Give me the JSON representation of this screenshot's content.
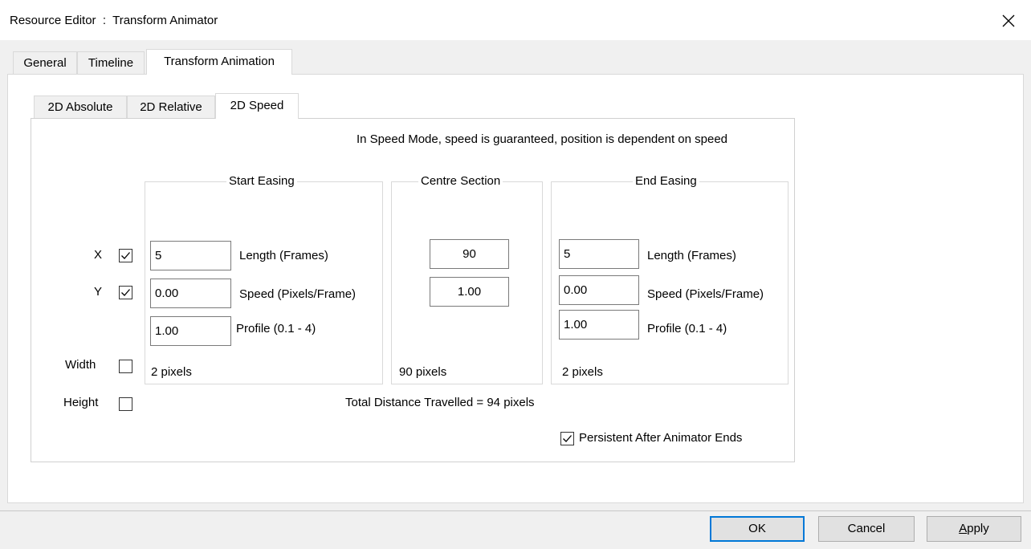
{
  "window": {
    "title": "Resource Editor  :  Transform Animator"
  },
  "tabs": [
    {
      "label": "General"
    },
    {
      "label": "Timeline"
    },
    {
      "label": "Transform Animation"
    }
  ],
  "subtabs": [
    {
      "label": "2D Absolute"
    },
    {
      "label": "2D Relative"
    },
    {
      "label": "2D Speed"
    }
  ],
  "info_text": "In Speed Mode, speed is guaranteed, position is dependent on speed",
  "axes": [
    {
      "label": "X",
      "checked": true
    },
    {
      "label": "Y",
      "checked": true
    },
    {
      "label": "Width",
      "checked": false
    },
    {
      "label": "Height",
      "checked": false
    }
  ],
  "start_easing": {
    "title": "Start Easing",
    "length": "5",
    "speed": "0.00",
    "profile": "1.00",
    "length_label": "Length (Frames)",
    "speed_label": "Speed (Pixels/Frame)",
    "profile_label": "Profile (0.1 - 4)",
    "distance": "2 pixels"
  },
  "centre_section": {
    "title": "Centre Section",
    "length": "90",
    "speed": "1.00",
    "distance": "90 pixels"
  },
  "end_easing": {
    "title": "End Easing",
    "length": "5",
    "speed": "0.00",
    "profile": "1.00",
    "length_label": "Length (Frames)",
    "speed_label": "Speed (Pixels/Frame)",
    "profile_label": "Profile (0.1 - 4)",
    "distance": "2 pixels"
  },
  "total_distance": "Total Distance Travelled = 94 pixels",
  "persistent": {
    "label": "Persistent After Animator Ends",
    "checked": true
  },
  "buttons": {
    "ok": "OK",
    "cancel": "Cancel",
    "apply_rest": "pply",
    "apply_mnemonic": "A"
  },
  "icons": {
    "close": "close-icon",
    "check": "checkmark-icon"
  }
}
